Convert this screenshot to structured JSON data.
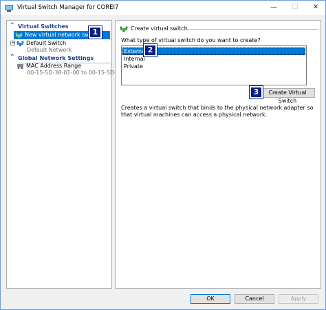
{
  "window": {
    "title": "Virtual Switch Manager for COREI7",
    "min_glyph": "—",
    "max_glyph": "☐",
    "close_glyph": "✕"
  },
  "left_pane": {
    "sections": [
      {
        "label": "Virtual Switches",
        "chevron": "⌃"
      },
      {
        "label": "Global Network Settings",
        "chevron": "⌃"
      }
    ],
    "items": [
      {
        "label": "New virtual network switch",
        "icon": "network-switch-new-icon",
        "selected": true
      },
      {
        "label": "Default Switch",
        "sub": "Default Network",
        "icon": "network-switch-icon",
        "expander": "+"
      },
      {
        "label": "MAC Address Range",
        "sub": "00-15-5D-38-01-00 to 00-15-5D-3...",
        "icon": "network-adapter-icon"
      }
    ]
  },
  "right_pane": {
    "header": "Create virtual switch",
    "question": "What type of virtual switch do you want to create?",
    "options": [
      "External",
      "Internal",
      "Private"
    ],
    "selected_option": "External",
    "create_button": "Create Virtual Switch",
    "description": "Creates a virtual switch that binds to the physical network adapter so that virtual machines can access a physical network."
  },
  "footer": {
    "ok": "OK",
    "cancel": "Cancel",
    "apply": "Apply"
  },
  "callouts": [
    "1",
    "2",
    "3"
  ],
  "colors": {
    "selection": "#0078d7",
    "callout": "#0a1f80",
    "section_header": "#1e3b8a"
  }
}
